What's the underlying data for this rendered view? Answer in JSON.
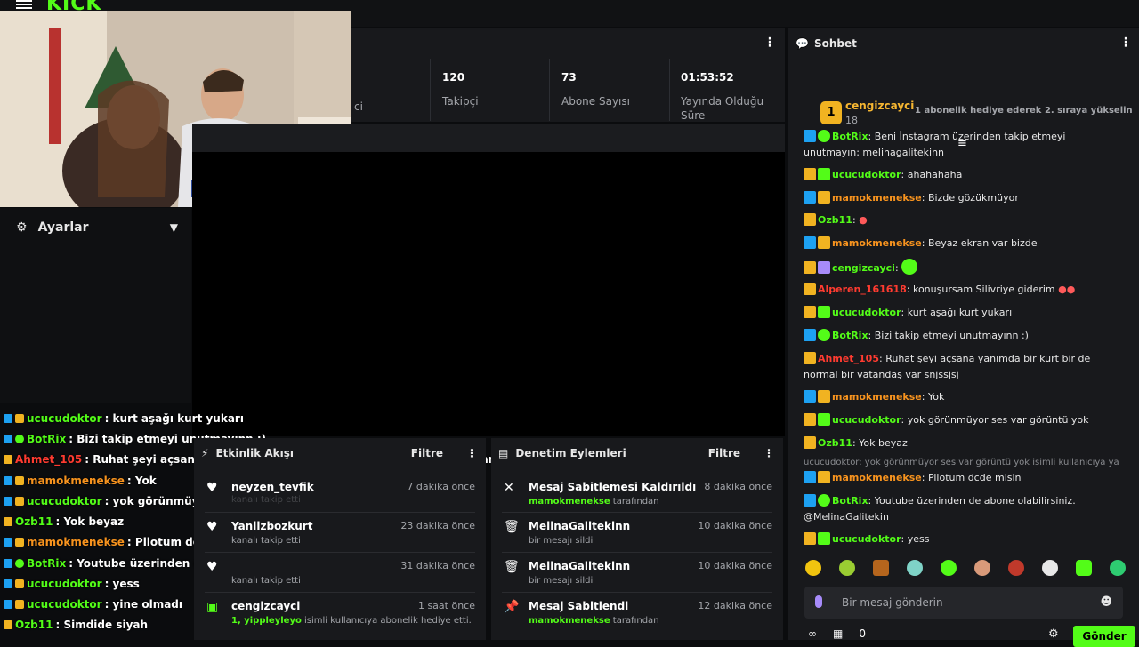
{
  "brand": {
    "logo_text": "KICK",
    "accent": "#53fc18"
  },
  "settings": {
    "label": "Ayarlar"
  },
  "stats": [
    {
      "value": "120",
      "label": "Takipçi"
    },
    {
      "value": "73",
      "label": "Abone Sayısı"
    },
    {
      "value": "01:53:52",
      "label": "Yayında Olduğu Süre"
    }
  ],
  "stats_partial_label": "ci",
  "overlay_chat": [
    {
      "user": "ucucudoktor",
      "color": "#53fc18",
      "text": " : kurt aşağı kurt yukarı"
    },
    {
      "user": "BotRix",
      "color": "#53fc18",
      "text": " : Bizi takip etmeyi unutmayınn :)"
    },
    {
      "user": "Ahmet_105",
      "color": "#ff3b30",
      "text": " : Ruhat şeyi açsana yanımda bir kurt bir de normal bir vatandaş var snjssjsj"
    },
    {
      "user": "mamokmenekse",
      "color": "#f7931e",
      "text": " : Yok"
    },
    {
      "user": "ucucudoktor",
      "color": "#53fc18",
      "text": " : yok görünmüyor ses var görüntü yok"
    },
    {
      "user": "Ozb11",
      "color": "#53fc18",
      "text": " : Yok beyaz"
    },
    {
      "user": "mamokmenekse",
      "color": "#f7931e",
      "text": " : Pilotum dcde misin"
    },
    {
      "user": "BotRix",
      "color": "#53fc18",
      "text": " : Youtube üzerinden de abone olabilirsiniz. @MelinaGalitekin"
    },
    {
      "user": "ucucudoktor",
      "color": "#53fc18",
      "text": " : yess"
    },
    {
      "user": "ucucudoktor",
      "color": "#53fc18",
      "text": " : yine olmadı"
    },
    {
      "user": "Ozb11",
      "color": "#53fc18",
      "text": " : Simdide siyah"
    }
  ],
  "activity": {
    "title": "Etkinlik Akışı",
    "filter": "Filtre",
    "items": [
      {
        "name": "neyzen_tevfik",
        "sub": "kanalı takip etti",
        "time": "7 dakika önce"
      },
      {
        "name": "Yanlizbozkurt",
        "sub": "kanalı takip etti",
        "time": "23 dakika önce"
      },
      {
        "name": "",
        "sub": "kanalı takip etti",
        "time": "31 dakika önce"
      },
      {
        "name": "cengizcayci",
        "sub_user": "1, yippleyleyo",
        "sub": " isimli kullanıcıya abonelik hediye etti.",
        "time": "1 saat önce"
      }
    ]
  },
  "moderation": {
    "title": "Denetim Eylemleri",
    "filter": "Filtre",
    "items": [
      {
        "name": "Mesaj Sabitlemesi Kaldırıldı",
        "sub_user": "mamokmenekse",
        "sub": " tarafından",
        "time": "8 dakika önce"
      },
      {
        "name": "MelinaGalitekinn",
        "sub": "bir mesajı sildi",
        "time": "10 dakika önce"
      },
      {
        "name": "MelinaGalitekinn",
        "sub": "bir mesajı sildi",
        "time": "10 dakika önce"
      },
      {
        "name": "Mesaj Sabitlendi",
        "sub_user": "mamokmenekse",
        "sub": " tarafından",
        "time": "12 dakika önce"
      }
    ]
  },
  "chat": {
    "title": "Sohbet",
    "pinned": {
      "rank": "1",
      "user": "cengizcayci",
      "count": "18",
      "hint": "1 abonelik hediye ederek 2. sıraya yükselin"
    },
    "messages": [
      {
        "user": "BotRix",
        "color": "#53fc18",
        "text": ": Beni İnstagram üzerinden takip etmeyi unutmayın: melinagalitekinn"
      },
      {
        "user": "ucucudoktor",
        "color": "#53fc18",
        "text": ": ahahahaha"
      },
      {
        "user": "mamokmenekse",
        "color": "#f7931e",
        "text": ": Bizde gözükmüyor"
      },
      {
        "user": "Ozb11",
        "color": "#53fc18",
        "text": ":"
      },
      {
        "user": "mamokmenekse",
        "color": "#f7931e",
        "text": ": Beyaz ekran var bizde"
      },
      {
        "user": "cengizcayci",
        "color": "#53fc18",
        "text": ":"
      },
      {
        "user": "Alperen_161618",
        "color": "#ff3b30",
        "text": ": konuşursam Silivriye giderim"
      },
      {
        "user": "ucucudoktor",
        "color": "#53fc18",
        "text": ": kurt aşağı kurt yukarı"
      },
      {
        "user": "BotRix",
        "color": "#53fc18",
        "text": ": Bizi takip etmeyi unutmayınn :)"
      },
      {
        "user": "Ahmet_105",
        "color": "#ff3b30",
        "text": ": Ruhat şeyi açsana yanımda bir kurt bir de normal bir vatandaş var snjssjsj"
      },
      {
        "user": "mamokmenekse",
        "color": "#f7931e",
        "text": ": Yok"
      },
      {
        "user": "ucucudoktor",
        "color": "#53fc18",
        "text": ": yok görünmüyor ses var görüntü yok"
      },
      {
        "user": "Ozb11",
        "color": "#53fc18",
        "text": ": Yok beyaz"
      },
      {
        "user": "mamokmenekse",
        "color": "#f7931e",
        "text": ": Pilotum dcde misin"
      },
      {
        "user": "BotRix",
        "color": "#53fc18",
        "text": ": Youtube üzerinden de abone olabilirsiniz. @MelinaGalitekin"
      },
      {
        "user": "ucucudoktor",
        "color": "#53fc18",
        "text": ": yess"
      }
    ],
    "reply_preview": "ucucudoktor: yok görünmüyor ses var görüntü yok isimli kullanıcıya ya...",
    "input_placeholder": "Bir mesaj gönderin",
    "points": "0",
    "send_label": "Gönder"
  }
}
